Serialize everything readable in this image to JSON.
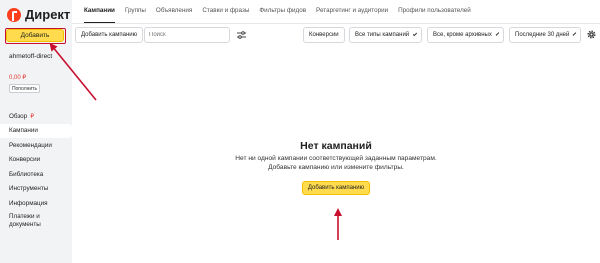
{
  "logo": {
    "text": "Директ"
  },
  "sidebar": {
    "add_button": "Добавить",
    "account": "ahmetoff-direct",
    "balance": "0,00 ₽",
    "topup_button": "Пополнить",
    "items": [
      {
        "label": "Обзор",
        "suffix": "₽"
      },
      {
        "label": "Кампании"
      },
      {
        "label": "Рекомендации"
      },
      {
        "label": "Конверсии"
      },
      {
        "label": "Библиотека"
      },
      {
        "label": "Инструменты"
      },
      {
        "label": "Информация"
      },
      {
        "label": "Платежи и документы"
      }
    ]
  },
  "tabs": [
    {
      "label": "Кампании"
    },
    {
      "label": "Группы"
    },
    {
      "label": "Объявления"
    },
    {
      "label": "Ставки и фразы"
    },
    {
      "label": "Фильтры фидов"
    },
    {
      "label": "Ретаргетинг и аудитории"
    },
    {
      "label": "Профили пользователей"
    }
  ],
  "toolbar": {
    "add_campaign": "Добавить кампанию",
    "search_placeholder": "Поиск",
    "conversions": "Конверсии",
    "campaign_types": "Все типы кампаний",
    "status_filter": "Все, кроме архивных",
    "period": "Последние 30 дней"
  },
  "empty_state": {
    "title": "Нет кампаний",
    "line1": "Нет ни одной кампании соответствующей заданным параметрам.",
    "line2": "Добавьте кампанию или измените фильтры.",
    "button": "Добавить кампанию"
  },
  "colors": {
    "accent_yellow": "#ffdb4d",
    "annotation_red": "#c8102e",
    "sidebar_bg": "#f2f3f5"
  }
}
